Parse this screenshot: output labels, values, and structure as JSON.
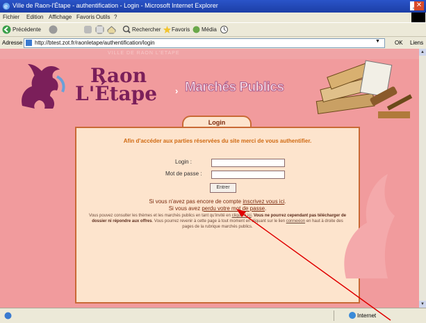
{
  "window": {
    "title": "Ville de Raon-l'Étape - authentification - Login - Microsoft Internet Explorer",
    "minimize": "_",
    "close": "✕"
  },
  "menu": [
    "Fichier",
    "Edition",
    "Affichage",
    "Favoris",
    "Outils",
    "?"
  ],
  "toolbar": {
    "back_label": "Précédente",
    "search_label": "Rechercher",
    "favorites_label": "Favoris",
    "media_label": "Média"
  },
  "address": {
    "label": "Adresse",
    "url": "http://btest.zot.fr/raonletape/authentification/login",
    "go_label": "OK",
    "links_label": "Liens"
  },
  "header": {
    "band_text": "VILLE DE RAON L'ETAPE",
    "logo_line1": "Raon",
    "logo_line2": "L'Étape",
    "arrow": "›",
    "section_title": "Marchés Publics"
  },
  "login": {
    "tab_label": "Login",
    "intro": "Afin d'accéder aux parties réservées du site merci de vous authentifier.",
    "login_label": "Login :",
    "password_label": "Mot de passe :",
    "submit_label": "Entrer",
    "no_account_text": "Si vous n'avez pas encore de compte",
    "signup_link": "inscrivez vous ici",
    "lost_prefix": "Si vous avez",
    "lost_link": "perdu votre mot de passe",
    "info_line1": "Vous pouvez consulter les thèmes et les marchés publics en tant qu'invité en",
    "info_link1": "cliquant ici",
    "info_line2": "Vous ne pourrez cependant pas télécharger de dossier ni répondre aux offres",
    "info_line3": "Vous pourrez revenir à cette page à tout moment en cliquant sur le lien",
    "info_link2": "connexion",
    "info_line4": "en haut à droite des pages de la rubrique marchés publics."
  },
  "status": {
    "zone": "Internet"
  },
  "colors": {
    "page_bg": "#f19b9d",
    "panel_bg": "#fde4cd",
    "panel_border": "#c96a36",
    "intro_text": "#d06a12",
    "logo": "#7b1f5a",
    "annotation_arrow": "#e00000"
  }
}
